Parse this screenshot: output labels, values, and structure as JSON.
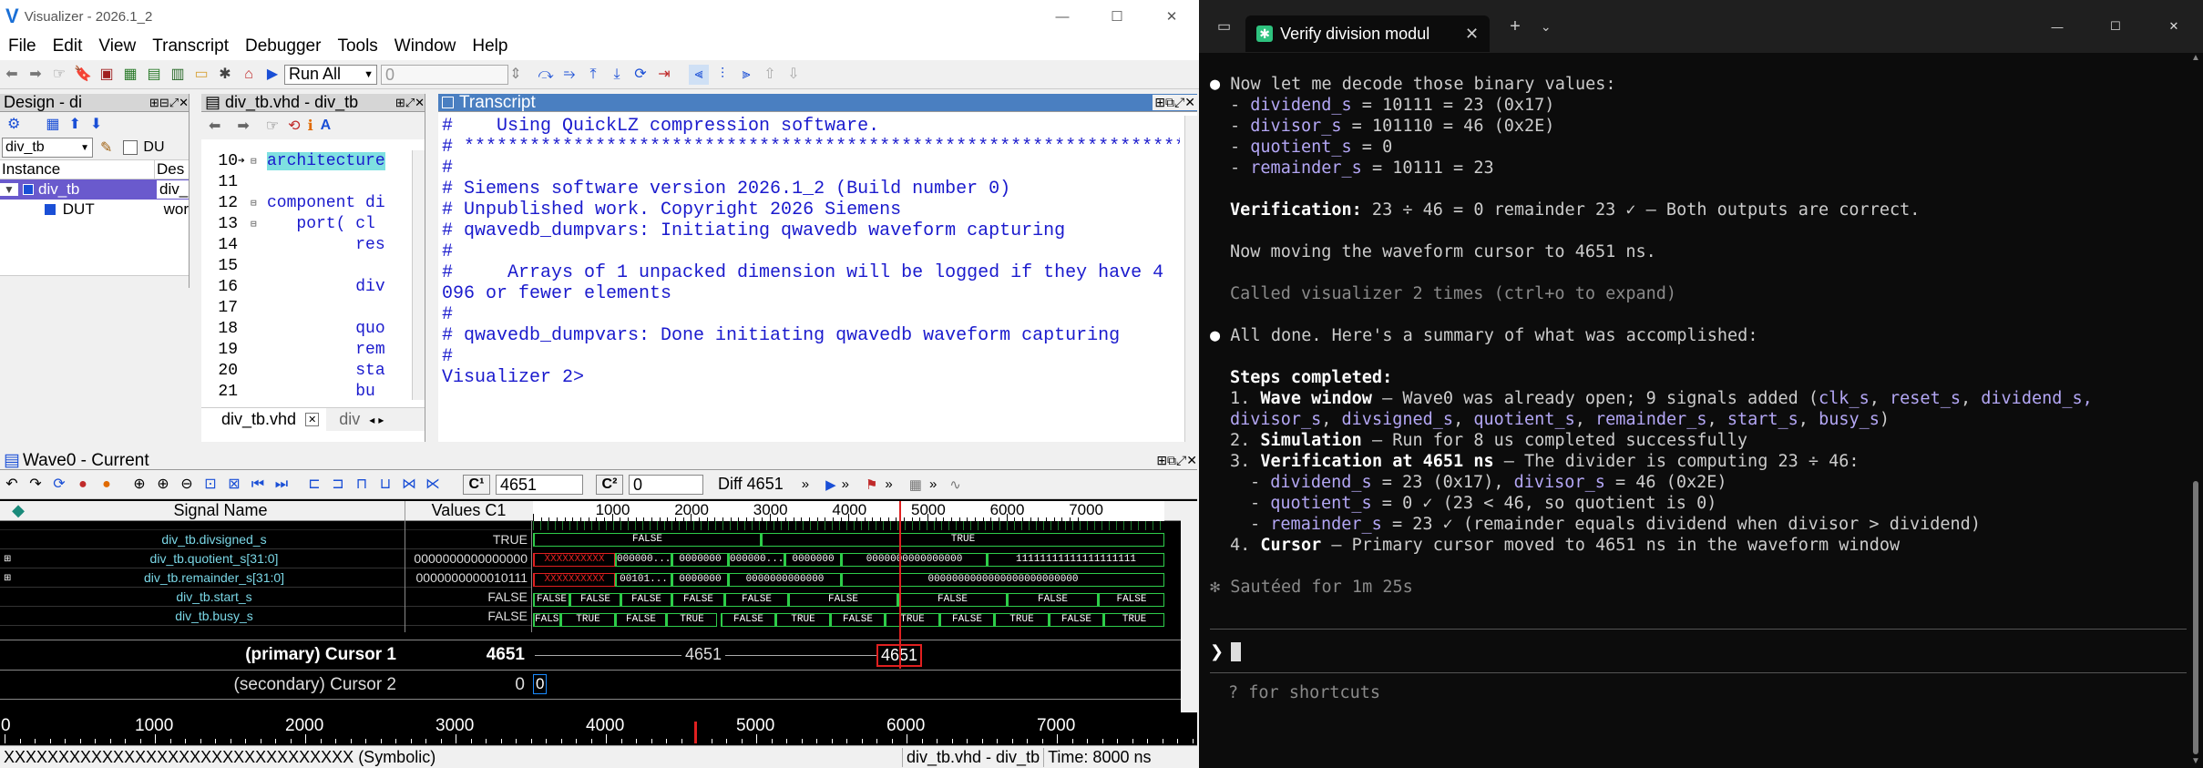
{
  "visualizer": {
    "title": "Visualizer - 2026.1_2",
    "menu": [
      "File",
      "Edit",
      "View",
      "Transcript",
      "Debugger",
      "Tools",
      "Window",
      "Help"
    ],
    "run_select": "Run All",
    "run_input": "0",
    "design_pane": {
      "title": "Design - di",
      "scope": "div_tb",
      "du_label": "DU",
      "col_instance": "Instance",
      "col_des": "Des",
      "rows": [
        {
          "name": "div_tb",
          "des": "div_"
        },
        {
          "name": "DUT",
          "des": "wor"
        }
      ]
    },
    "source_pane": {
      "title": "div_tb.vhd - div_tb",
      "tab": "div_tb.vhd",
      "tab2": "div",
      "lines": [
        {
          "n": "10",
          "code": "architecture"
        },
        {
          "n": "11",
          "code": ""
        },
        {
          "n": "12",
          "code": "component di"
        },
        {
          "n": "13",
          "code": "   port( cl"
        },
        {
          "n": "14",
          "code": "         res"
        },
        {
          "n": "15",
          "code": ""
        },
        {
          "n": "16",
          "code": "         div"
        },
        {
          "n": "17",
          "code": ""
        },
        {
          "n": "18",
          "code": "         quo"
        },
        {
          "n": "19",
          "code": "         rem"
        },
        {
          "n": "20",
          "code": "         sta"
        },
        {
          "n": "21",
          "code": "         bu"
        }
      ]
    },
    "transcript": {
      "title": "Transcript",
      "lines": [
        "#    Using QuickLZ compression software.",
        "# ******************************************************************",
        "#",
        "# Siemens software version 2026.1_2 (Build number 0)",
        "# Unpublished work. Copyright 2026 Siemens",
        "# qwavedb_dumpvars: Initiating qwavedb waveform capturing",
        "#",
        "#     Arrays of 1 unpacked dimension will be logged if they have 4",
        "096 or fewer elements",
        "#",
        "# qwavedb_dumpvars: Done initiating qwavedb waveform capturing",
        "#",
        "",
        "Visualizer 2>"
      ]
    },
    "wave": {
      "title": "Wave0 - Current",
      "cursor1_input": "4651",
      "cursor2_input": "0",
      "diff": "Diff 4651",
      "col_signal": "Signal Name",
      "col_values": "Values C1",
      "ruler_ticks": [
        "1000",
        "2000",
        "3000",
        "4000",
        "5000",
        "6000",
        "7000"
      ],
      "signals": [
        {
          "name": "div_tb.divsigned_s",
          "value": "TRUE"
        },
        {
          "name": "div_tb.quotient_s[31:0]",
          "value": "0000000000000000"
        },
        {
          "name": "div_tb.remainder_s[31:0]",
          "value": "0000000000010111"
        },
        {
          "name": "div_tb.start_s",
          "value": "FALSE"
        },
        {
          "name": "div_tb.busy_s",
          "value": "FALSE"
        }
      ],
      "cursor1": {
        "label": "(primary) Cursor 1",
        "value": "4651",
        "time_label": "4651",
        "mid_label": "4651"
      },
      "cursor2": {
        "label": "(secondary) Cursor 2",
        "value": "0",
        "time_label": "0"
      },
      "bottom_ticks": [
        "0",
        "1000",
        "2000",
        "3000",
        "4000",
        "5000",
        "6000",
        "7000"
      ],
      "status_left": "XXXXXXXXXXXXXXXXXXXXXXXXXXXXXXXX (Symbolic)",
      "status_mid": "div_tb.vhd - div_tb",
      "status_right": "Time: 8000 ns",
      "wave_labels": {
        "divsigned_false": "FALSE",
        "divsigned_true": "TRUE",
        "q_x": "XXXXXXXXXX",
        "q_a": "000000...",
        "q_b": "0000000",
        "q_c": "000000...",
        "q_d": "0000000",
        "q_e": "0000000000000000",
        "q_f": "11111111111111111111",
        "r_x": "XXXXXXXXXX",
        "r_a": "00101...",
        "r_b": "0000000",
        "r_c": "0000000000000",
        "r_e": "0000000000000000000000000",
        "start_false": "FALSE",
        "busy_true": "TRUE",
        "busy_false": "FALSE"
      }
    }
  },
  "terminal": {
    "tab_title": "Verify division modul",
    "lines": [
      {
        "kind": "bullet",
        "text": "Now let me decode those binary values:"
      },
      {
        "kind": "item",
        "key": "dividend_s",
        "rest": " = 10111 = 23 (0x17)"
      },
      {
        "kind": "item",
        "key": "divisor_s",
        "rest": " = 101110 = 46 (0x2E)"
      },
      {
        "kind": "item",
        "key": "quotient_s",
        "rest": " = 0"
      },
      {
        "kind": "item",
        "key": "remainder_s",
        "rest": " = 10111 = 23"
      }
    ],
    "verification_bold": "Verification:",
    "verification_rest": " 23 ÷ 46 = 0 remainder 23 ✓ — Both outputs are correct.",
    "moving": "Now moving the waveform cursor to 4651 ns.",
    "called": "Called visualizer 2 times (ctrl+o to expand)",
    "done": "All done. Here's a summary of what was accomplished:",
    "steps_title": "Steps completed:",
    "step1_bold": "Wave window",
    "step1_rest": " — Wave0 was already open; 9 signals added (",
    "step1_sigs_a": [
      "clk_s",
      "reset_s",
      "dividend_s,"
    ],
    "step1_sigs_b": [
      "divisor_s",
      "divsigned_s",
      "quotient_s",
      "remainder_s",
      "start_s",
      "busy_s"
    ],
    "step2_bold": "Simulation",
    "step2_rest": " — Run for 8 us completed successfully",
    "step3_bold": "Verification at 4651 ns",
    "step3_rest": " — The divider is computing 23 ÷ 46:",
    "sub1_key": "dividend_s",
    "sub1_a": " = 23 (0x17), ",
    "sub1_key2": "divisor_s",
    "sub1_b": " = 46 (0x2E)",
    "sub2_key": "quotient_s",
    "sub2_rest": " = 0 ✓ (23 < 46, so quotient is 0)",
    "sub3_key": "remainder_s",
    "sub3_rest": " = 23 ✓ (remainder equals dividend when divisor > dividend)",
    "step4_bold": "Cursor",
    "step4_rest": " — Primary cursor moved to 4651 ns in the waveform window",
    "sauteed": "✻ Sautéed for 1m 25s",
    "prompt": "❯",
    "shortcuts": "? for shortcuts",
    "colors": {
      "accent": "#b4a7f5",
      "bg": "#0c0c0c"
    }
  }
}
